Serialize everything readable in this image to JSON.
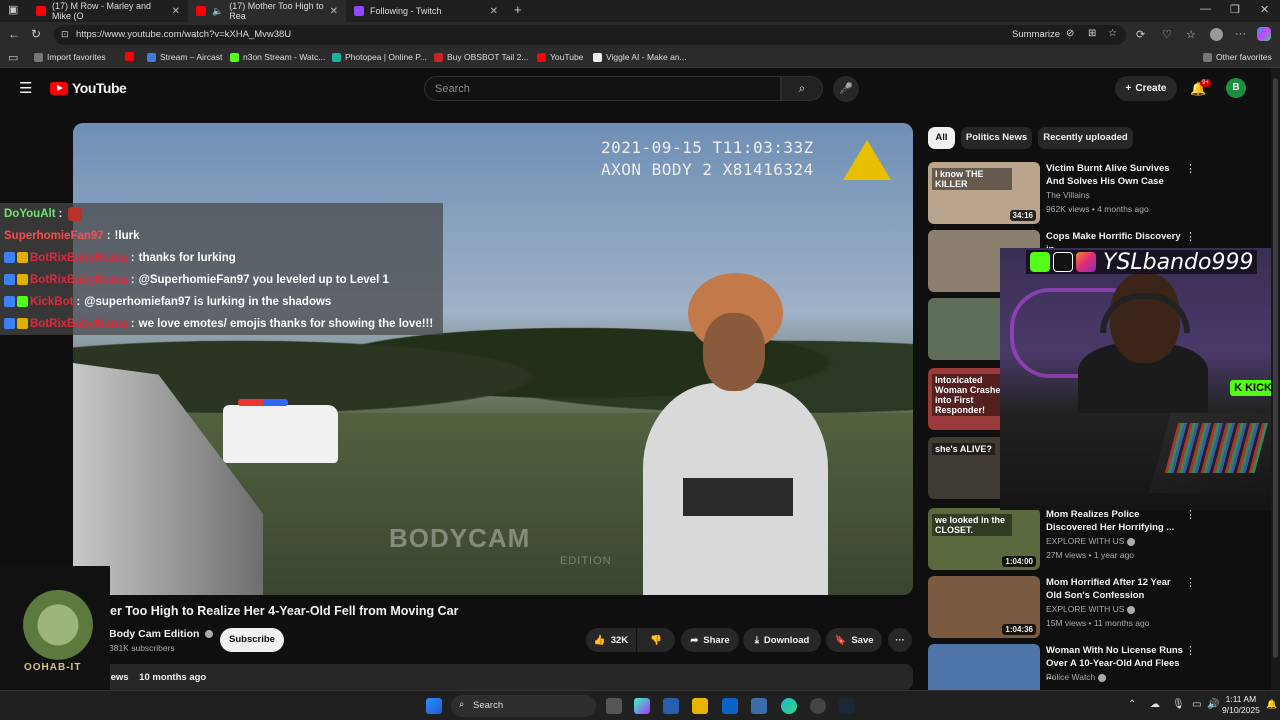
{
  "browser": {
    "tabs": [
      {
        "label": "(17) M Row - Marley and Mike (O",
        "favicon_color": "#ff0000"
      },
      {
        "label": "(17) Mother Too High to Rea",
        "favicon_color": "#ff0000",
        "audio_icon": "speaker-icon"
      },
      {
        "label": "Following - Twitch",
        "favicon_color": "#9146ff"
      }
    ],
    "new_tab_label": "+",
    "url": "https://www.youtube.com/watch?v=kXHA_Mvw38U",
    "summarize_label": "Summarize",
    "favorites": [
      {
        "label": "Import favorites",
        "color": "#777777"
      },
      {
        "label": "Stream – Aircast",
        "color": "#3f7be0"
      },
      {
        "label": "n3on Stream - Watc...",
        "color": "#53fc18"
      },
      {
        "label": "Photopea | Online P...",
        "color": "#1ab0a5"
      },
      {
        "label": "Buy OBSBOT Tail 2...",
        "color": "#cc2222"
      },
      {
        "label": "YouTube",
        "color": "#ff0000"
      },
      {
        "label": "Viggle AI - Make an...",
        "color": "#222222"
      }
    ],
    "other_favorites": "Other favorites"
  },
  "youtube": {
    "logo_text": "YouTube",
    "search_placeholder": "Search",
    "create_label": "Create",
    "notification_count": "9+",
    "avatar_letter": "B"
  },
  "video": {
    "timestamp_line1": "2021-09-15 T11:03:33Z",
    "timestamp_line2": "AXON BODY 2 X81416324",
    "watermark": "BODYCAM",
    "watermark_sub": "EDITION",
    "title": "er Too High to Realize Her 4-Year-Old Fell from Moving Car",
    "channel": "Body Cam Edition",
    "subscribers": "381K subscribers",
    "subscribe_label": "Subscribe",
    "likes": "32K",
    "share_label": "Share",
    "download_label": "Download",
    "save_label": "Save",
    "views_fragment": "iews",
    "posted": "10 months ago"
  },
  "chat": [
    {
      "user": "DoYouAlt",
      "sep": ":",
      "msg": "",
      "user_color": "#6fe36f",
      "badges": []
    },
    {
      "user": "SuperhomieFan97",
      "sep": ":",
      "msg": "!lurk",
      "user_color": "#ff4d4d",
      "badges": []
    },
    {
      "user": "BotRixBabyMama",
      "sep": ":",
      "msg": "thanks for lurking",
      "user_color": "#e0283c",
      "badges": [
        "#3b82f6",
        "#e0b000"
      ]
    },
    {
      "user": "BotRixBabyMama",
      "sep": ":",
      "msg": "@SuperhomieFan97 you leveled up to Level 1",
      "user_color": "#e0283c",
      "badges": [
        "#3b82f6",
        "#e0b000"
      ]
    },
    {
      "user": "KickBot",
      "sep": ":",
      "msg": "@superhomiefan97 is lurking in the shadows",
      "user_color": "#e0283c",
      "badges": [
        "#3b82f6",
        "#53fc18"
      ]
    },
    {
      "user": "BotRixBabyMama",
      "sep": ":",
      "msg": "we love emotes/ emojis thanks for showing the love!!!",
      "user_color": "#e0283c",
      "badges": [
        "#3b82f6",
        "#e0b000"
      ]
    }
  ],
  "filters": [
    "All",
    "Politics News",
    "Recently uploaded"
  ],
  "recommendations": [
    {
      "title": "Victim Burnt Alive Survives And Solves His Own Case",
      "channel": "The Villains",
      "meta": "962K views • 4 months ago",
      "duration": "34:16",
      "verified": false,
      "thumb_color": "#b9a48c"
    },
    {
      "title": "Cops Make Horrific Discovery in",
      "channel": "",
      "meta": "",
      "duration": "",
      "verified": false,
      "thumb_color": "#8c7f70"
    },
    {
      "title": "",
      "channel": "",
      "meta": "",
      "duration": "",
      "verified": false,
      "thumb_color": "#5e6d5a"
    },
    {
      "title": "",
      "channel": "",
      "meta": "",
      "duration": "",
      "verified": false,
      "thumb_color": "#9a3a3a"
    },
    {
      "title": "",
      "channel": "",
      "meta": "",
      "duration": "",
      "verified": false,
      "thumb_color": "#403a35"
    },
    {
      "title": "Mom Realizes Police Discovered Her Horrifying ...",
      "channel": "EXPLORE WITH US",
      "meta": "27M views • 1 year ago",
      "duration": "1:04:00",
      "verified": true,
      "thumb_color": "#5a6a3e"
    },
    {
      "title": "Mom Horrified After 12 Year Old Son's Confession",
      "channel": "EXPLORE WITH US",
      "meta": "15M views • 11 months ago",
      "duration": "1:04:36",
      "verified": true,
      "thumb_color": "#7a5a40"
    },
    {
      "title": "Woman With No License Runs Over A 10-Year-Old And Flees ...",
      "channel": "Police Watch",
      "meta": "",
      "duration": "",
      "verified": true,
      "thumb_color": "#4f76a8"
    }
  ],
  "thumb_texts": [
    "I know THE KILLER",
    "she's ALIVE?",
    "we looked in the CLOSET.",
    "Intoxicated Woman Crashes into First Responder!"
  ],
  "webcam": {
    "handle": "YSLbando999",
    "kick_badge": "K KICK"
  },
  "streamer_logo_text": "OOHAB-IT",
  "taskbar": {
    "search_placeholder": "Search",
    "time": "1:11 AM",
    "date": "9/10/2025"
  }
}
